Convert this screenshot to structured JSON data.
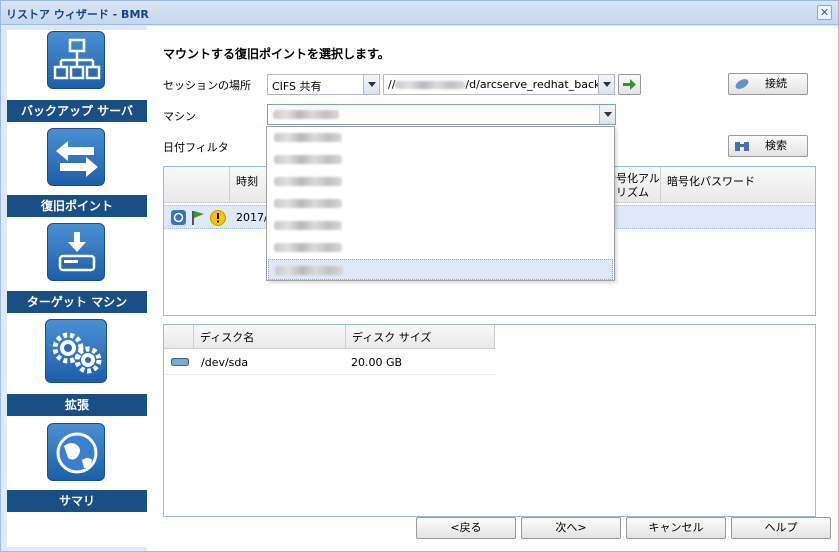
{
  "window": {
    "title": "リストア ウィザード - BMR",
    "close": "✕"
  },
  "sidebar": {
    "steps": [
      {
        "label": "バックアップ サーバ",
        "icon": "backup-server-icon"
      },
      {
        "label": "復旧ポイント",
        "icon": "recovery-point-icon"
      },
      {
        "label": "ターゲット マシン",
        "icon": "target-machine-icon"
      },
      {
        "label": "拡張",
        "icon": "advanced-gears-icon"
      },
      {
        "label": "サマリ",
        "icon": "summary-globe-icon"
      }
    ]
  },
  "main": {
    "heading": "マウントする復旧ポイントを選択します。",
    "session_location_label": "セッションの場所",
    "session_type": "CIFS 共有",
    "session_path_prefix": "//",
    "session_path_suffix": "/d/arcserve_redhat_backu",
    "connect_button": "接続",
    "machine_label": "マシン",
    "date_filter_label": "日付フィルタ",
    "search_button": "検索"
  },
  "recovery_grid": {
    "columns": [
      "時刻",
      "暗号化アル\nゴリズム",
      "暗号化パスワード"
    ],
    "row_time": "2017/"
  },
  "machine_dropdown": {
    "item_count": 7,
    "selected_index": 6
  },
  "disk_grid": {
    "columns": [
      "ディスク名",
      "ディスク サイズ"
    ],
    "rows": [
      {
        "name": "/dev/sda",
        "size": "20.00 GB"
      }
    ]
  },
  "footer": {
    "back": "<戻る",
    "next": "次へ>",
    "cancel": "キャンセル",
    "help": "ヘルプ"
  },
  "colors": {
    "sidebar_label_bg": "#1a4f86",
    "accent_green": "#2e9a2e",
    "selected_row": "#dfe8f6"
  }
}
